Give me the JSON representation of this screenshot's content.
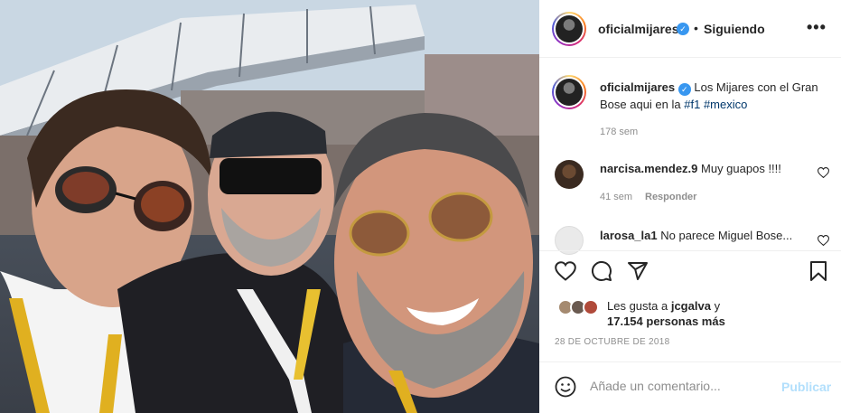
{
  "header": {
    "username": "oficialmijares",
    "separator": "•",
    "follow_status": "Siguiendo",
    "more_icon": "more-horizontal-icon"
  },
  "caption": {
    "username": "oficialmijares",
    "text": "Los Mijares con el Gran Bose aqui en la",
    "hashtags": [
      "#f1",
      "#mexico"
    ],
    "time": "178 sem"
  },
  "comments": [
    {
      "username": "narcisa.mendez.9",
      "text": "Muy guapos !!!!",
      "time": "41 sem",
      "reply_label": "Responder"
    },
    {
      "username": "larosa_la1",
      "text": "No parece Miguel Bose..."
    }
  ],
  "actions": {
    "like_icon": "heart-icon",
    "comment_icon": "comment-icon",
    "share_icon": "send-icon",
    "save_icon": "bookmark-icon"
  },
  "likes": {
    "prefix": "Les gusta a",
    "user": "jcgalva",
    "suffix": "y",
    "others": "17.154 personas más"
  },
  "post_date": "28 DE OCTUBRE DE 2018",
  "comment_bar": {
    "emoji_icon": "smiley-icon",
    "placeholder": "Añade un comentario...",
    "publish_label": "Publicar"
  },
  "colors": {
    "verified": "#3897f0",
    "hashtag": "#00376b",
    "publish_disabled": "#b2dffc",
    "secondary_text": "#8e8e8e"
  }
}
